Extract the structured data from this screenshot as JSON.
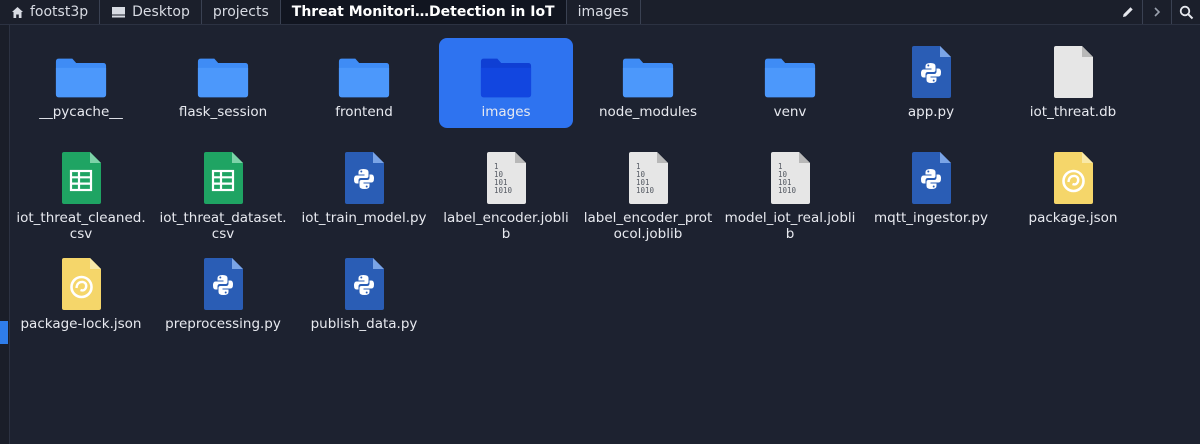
{
  "breadcrumbs": [
    {
      "label": "footst3p",
      "icon": "home-icon"
    },
    {
      "label": "Desktop",
      "icon": "desktop-icon"
    },
    {
      "label": "projects"
    },
    {
      "label": "Threat Monitori…Detection in IoT",
      "active": true
    },
    {
      "label": "images"
    }
  ],
  "toolbar": {
    "edit_icon": "pencil-icon",
    "nav_icon": "chevron-right-icon",
    "search_icon": "search-icon"
  },
  "files": [
    {
      "name": "__pycache__",
      "type": "folder"
    },
    {
      "name": "flask_session",
      "type": "folder"
    },
    {
      "name": "frontend",
      "type": "folder"
    },
    {
      "name": "images",
      "type": "folder",
      "selected": true
    },
    {
      "name": "node_modules",
      "type": "folder"
    },
    {
      "name": "venv",
      "type": "folder"
    },
    {
      "name": "app.py",
      "type": "python"
    },
    {
      "name": "iot_threat.db",
      "type": "blank"
    },
    {
      "name": "iot_threat_cleaned.csv",
      "type": "spreadsheet"
    },
    {
      "name": "iot_threat_dataset.csv",
      "type": "spreadsheet"
    },
    {
      "name": "iot_train_model.py",
      "type": "python"
    },
    {
      "name": "label_encoder.joblib",
      "type": "binary"
    },
    {
      "name": "label_encoder_protocol.joblib",
      "type": "binary"
    },
    {
      "name": "model_iot_real.joblib",
      "type": "binary"
    },
    {
      "name": "mqtt_ingestor.py",
      "type": "python"
    },
    {
      "name": "package.json",
      "type": "json"
    },
    {
      "name": "package-lock.json",
      "type": "json"
    },
    {
      "name": "preprocessing.py",
      "type": "python"
    },
    {
      "name": "publish_data.py",
      "type": "python"
    }
  ],
  "colors": {
    "background": "#1d2230",
    "selection": "#2e73f0",
    "folder": "#3f8cf5",
    "folder_selected": "#0f3fd4",
    "python_doc": "#2a5db5",
    "spreadsheet_doc": "#1fa463",
    "json_doc": "#f5d66a",
    "binary_doc": "#e6e6e6"
  }
}
